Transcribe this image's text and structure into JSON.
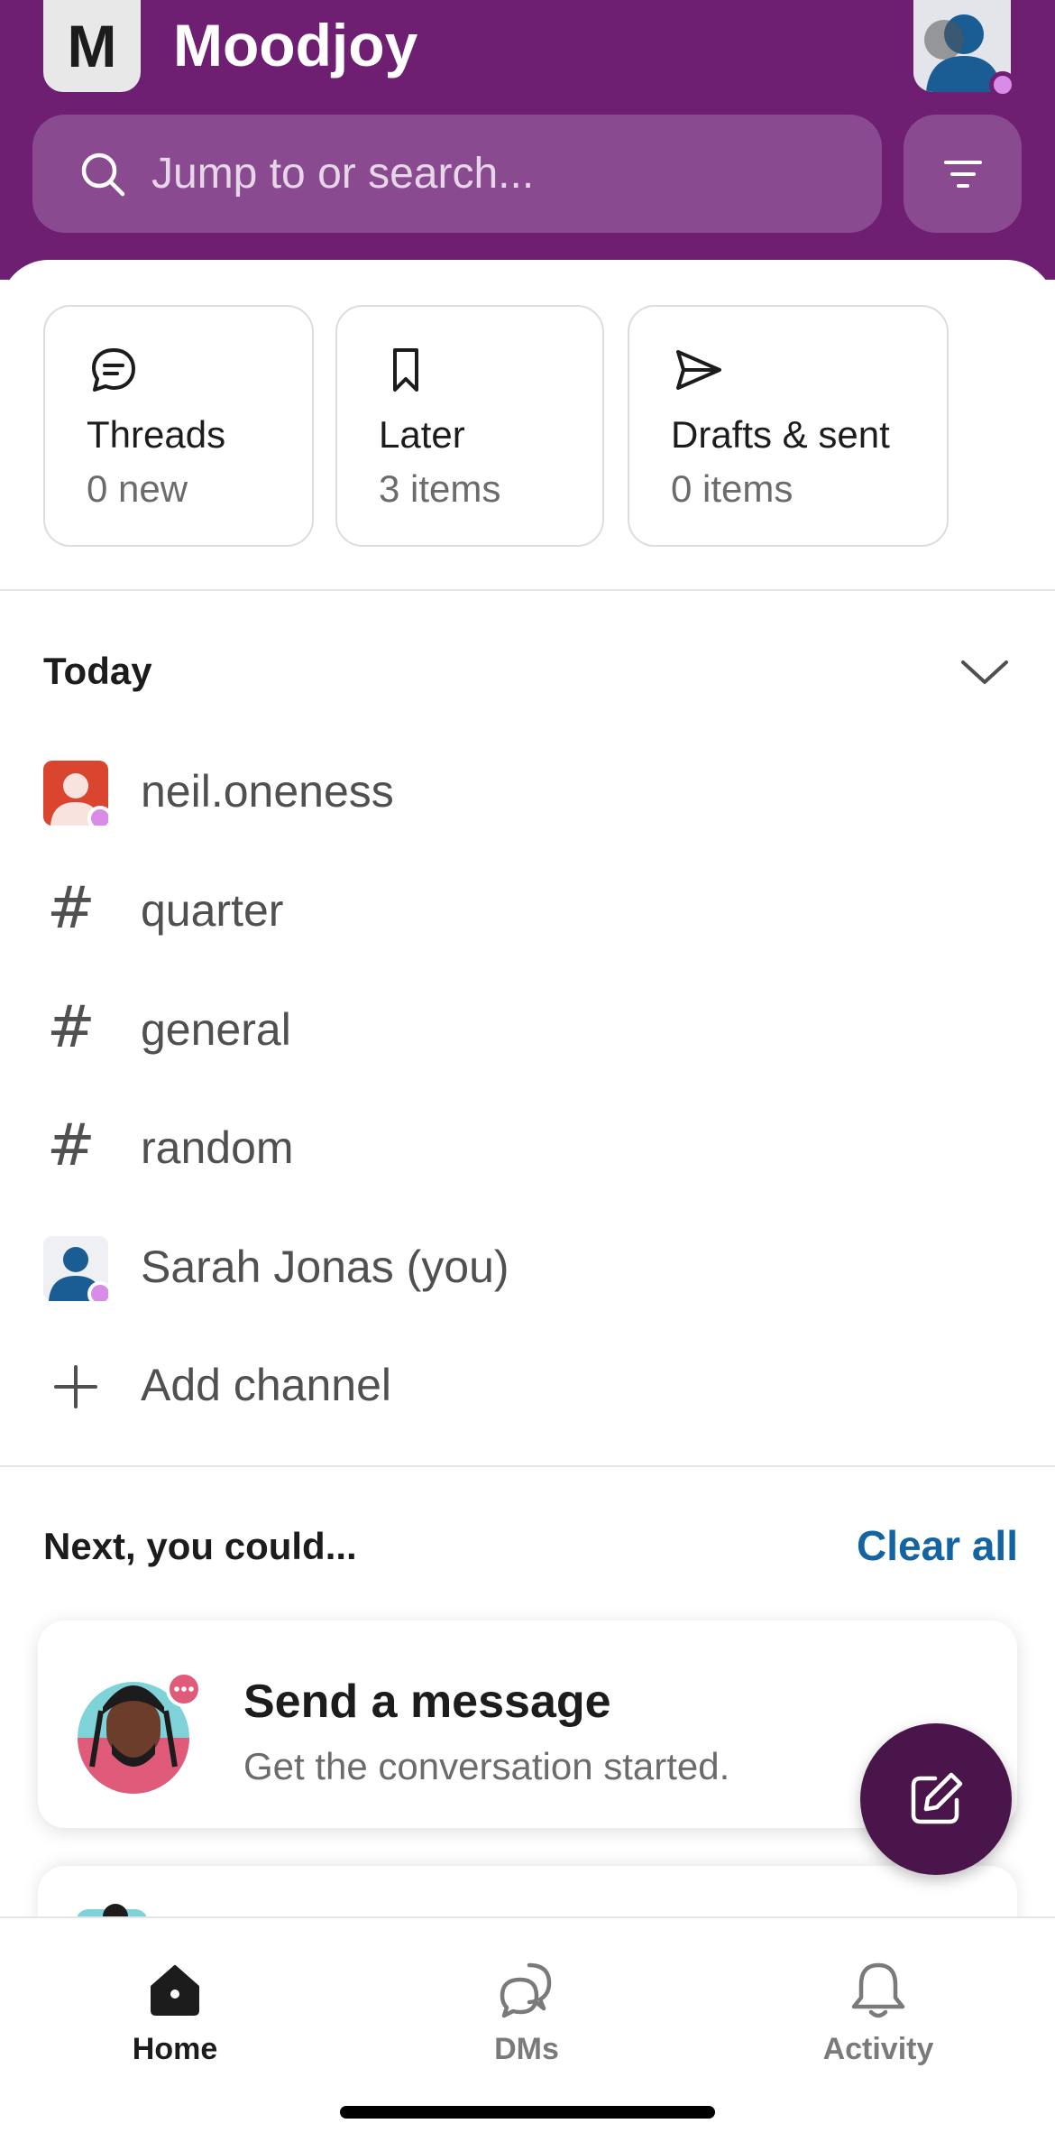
{
  "workspace": {
    "initial": "M",
    "name": "Moodjoy"
  },
  "search": {
    "placeholder": "Jump to or search..."
  },
  "quick_cards": [
    {
      "title": "Threads",
      "subtitle": "0 new",
      "icon": "threads-icon"
    },
    {
      "title": "Later",
      "subtitle": "3 items",
      "icon": "bookmark-icon"
    },
    {
      "title": "Drafts & sent",
      "subtitle": "0 items",
      "icon": "send-icon"
    }
  ],
  "today": {
    "title": "Today",
    "items": [
      {
        "label": "neil.oneness",
        "type": "dm"
      },
      {
        "label": "quarter",
        "type": "channel"
      },
      {
        "label": "general",
        "type": "channel"
      },
      {
        "label": "random",
        "type": "channel"
      },
      {
        "label": "Sarah Jonas (you)",
        "type": "dm"
      },
      {
        "label": "Add channel",
        "type": "action"
      }
    ]
  },
  "next": {
    "title": "Next, you could...",
    "clear_label": "Clear all",
    "suggestion": {
      "title": "Send a message",
      "subtitle": "Get the conversation started."
    }
  },
  "tabs": [
    {
      "label": "Home",
      "active": true
    },
    {
      "label": "DMs",
      "active": false
    },
    {
      "label": "Activity",
      "active": false
    }
  ],
  "colors": {
    "header": "#6e1f72",
    "fab": "#4a154b",
    "link": "#1264a3",
    "presence": "#d98be8"
  }
}
